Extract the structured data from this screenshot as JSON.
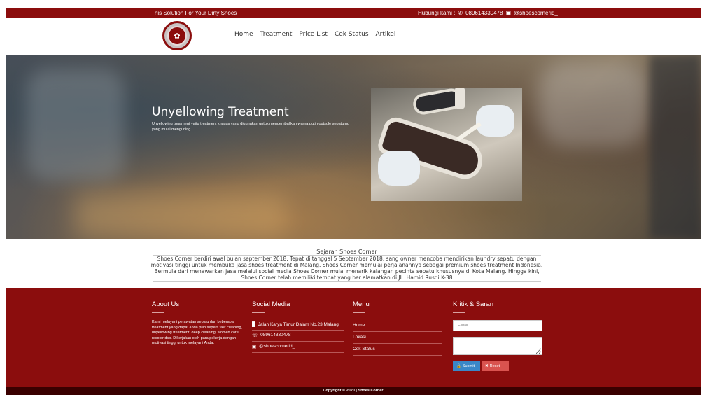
{
  "topbar": {
    "tagline": "This Solution For Your Dirty Shoes",
    "contact_label": "Hubungi kami :",
    "phone": "089614330478",
    "instagram": "@shoescornerid_",
    "phone_icon": "phone-icon",
    "instagram_icon": "instagram-icon"
  },
  "nav": {
    "items": [
      "Home",
      "Treatment",
      "Price List",
      "Cek Status",
      "Artikel"
    ]
  },
  "hero": {
    "title": "Unyellowing Treatment",
    "description": "Unyellowing treatment yaitu treatment khusus yang digunakan untuk mengembalikan warna putih outsole sepatumu yang mulai menguning"
  },
  "history": {
    "title": "Sejarah Shoes Corner",
    "text": "Shoes Corner berdiri awal bulan september 2018. Tepat di tanggal 5 September 2018, sang owner mencoba mendirikan laundry sepatu dengan motivasi tinggi untuk membuka jasa shoes treatment di Malang. Shoes Corner memulai perjalanannya sebagai premium shoes treatment Indonesia. Bermula dari menawarkan jasa melalui social media Shoes Corner mulai menarik kalangan pecinta sepatu khususnya di Kota Malang. Hingga kini, Shoes Corner telah memiliki tempat yang ber alamatkan di JL. Hamid Rusdi K-38"
  },
  "footer": {
    "about": {
      "heading": "About Us",
      "text": "Kami melayani perawatan sepatu dan beberapa treatment yang dapat anda pilih seperti fast cleaning, unyellowing treatment, deep cleaning, women care, recolor dsb. Dikerjakan oleh para pekerja dengan motivasi tinggi untuk melayani Anda."
    },
    "social": {
      "heading": "Social Media",
      "address": "Jalan Karya Timur Dalam No.23 Malang",
      "phone": "089614330478",
      "instagram": "@shoescornerid_"
    },
    "menu": {
      "heading": "Menu",
      "items": [
        "Home",
        "Lokasi",
        "Cek Status"
      ]
    },
    "kritik": {
      "heading": "Kritik & Saran",
      "email_placeholder": "E-Mail",
      "submit_label": "Submit",
      "reset_label": "Reset"
    }
  },
  "copyright": "Copyright © 2020 | Shoes Corner",
  "colors": {
    "brand": "#8b0d0d",
    "submit": "#3a87c8",
    "reset": "#d9534f"
  }
}
